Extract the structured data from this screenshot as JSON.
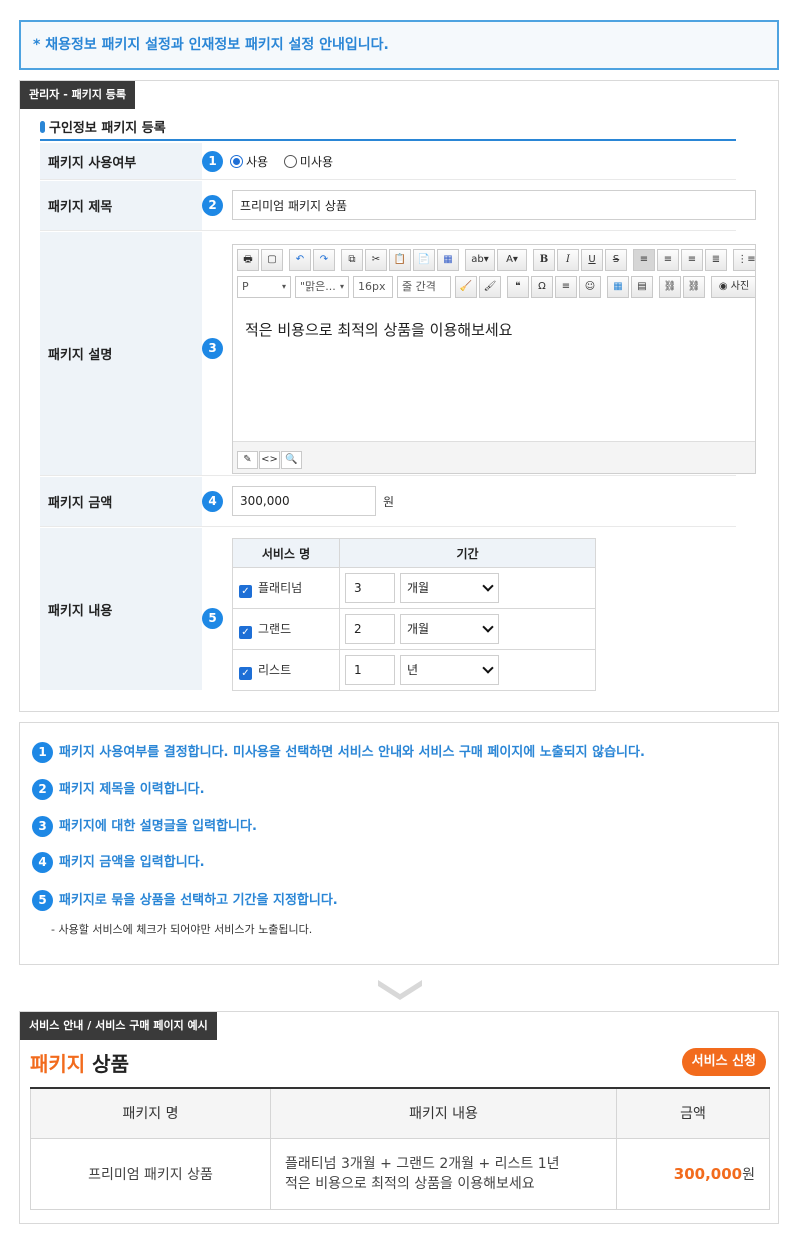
{
  "notice": "* 채용정보 패키지 설정과 인재정보 패키지 설정 안내입니다.",
  "admin": {
    "tag": "관리자 - 패키지 등록",
    "section_title": "구인정보 패키지 등록",
    "use": {
      "label": "패키지 사용여부",
      "num": "1",
      "options": [
        "사용",
        "미사용"
      ],
      "selected": "사용"
    },
    "title": {
      "label": "패키지 제목",
      "num": "2",
      "value": "프리미엄 패키지 상품"
    },
    "desc": {
      "label": "패키지 설명",
      "num": "3",
      "toolbar": {
        "format": "P",
        "font": "\"맑은...",
        "size": "16px",
        "line_height": "줄 간격",
        "omega": "Ω",
        "quote": "❝",
        "photo": "사진"
      },
      "body": "적은 비용으로 최적의 상품을 이용해보세요"
    },
    "price": {
      "label": "패키지 금액",
      "num": "4",
      "value": "300,000",
      "unit": "원"
    },
    "content": {
      "label": "패키지 내용",
      "num": "5",
      "headers": [
        "서비스 명",
        "기간"
      ],
      "rows": [
        {
          "name": "플래티넘",
          "checked": true,
          "qty": "3",
          "unit": "개월"
        },
        {
          "name": "그랜드",
          "checked": true,
          "qty": "2",
          "unit": "개월"
        },
        {
          "name": "리스트",
          "checked": true,
          "qty": "1",
          "unit": "년"
        }
      ]
    }
  },
  "help": {
    "items": [
      {
        "num": "1",
        "text": "패키지 사용여부를 결정합니다. 미사용을 선택하면 서비스 안내와 서비스 구매 페이지에 노출되지 않습니다."
      },
      {
        "num": "2",
        "text": "패키지 제목을 이력합니다."
      },
      {
        "num": "3",
        "text": "패키지에 대한 설명글을 입력합니다."
      },
      {
        "num": "4",
        "text": "패키지 금액을 입력합니다."
      },
      {
        "num": "5",
        "text": "패키지로 묶을 상품을 선택하고 기간을 지정합니다."
      }
    ],
    "sub": "- 사용할 서비스에 체크가 되어야만 서비스가 노출됩니다."
  },
  "preview": {
    "tag": "서비스 안내 / 서비스 구매 페이지 예시",
    "title_hl": "패키지",
    "title_rest": " 상품",
    "apply": "서비스 신청",
    "headers": [
      "패키지 명",
      "패키지 내용",
      "금액"
    ],
    "row": {
      "name": "프리미엄 패키지 상품",
      "content_line1": "플래티넘 3개월 + 그랜드 2개월 + 리스트 1년",
      "content_line2": "적은 비용으로 최적의 상품을 이용해보세요",
      "price": "300,000",
      "unit": "원"
    }
  },
  "colors": {
    "accent": "#1e88e5",
    "orange": "#f26b1d",
    "label_bg": "#eef3f8"
  }
}
